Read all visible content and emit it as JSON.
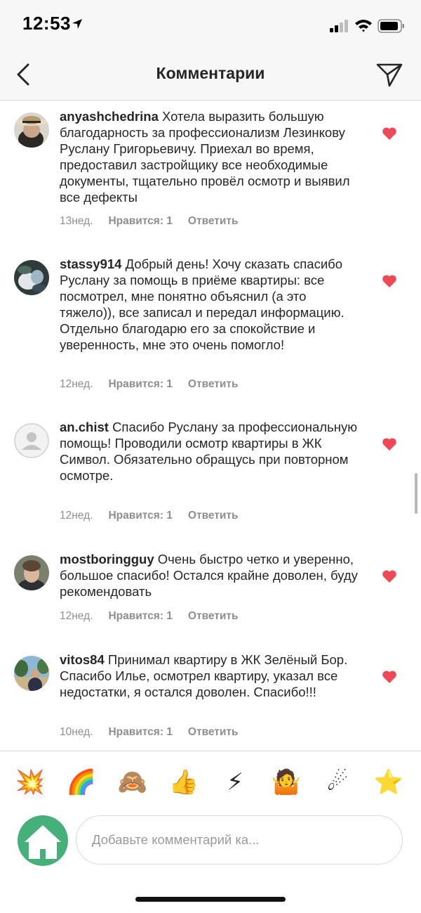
{
  "status": {
    "time": "12:53"
  },
  "header": {
    "title": "Комментарии"
  },
  "comments": [
    {
      "username": "anyashchedrina",
      "text": "Хотела выразить большую благодарность за профессионализм Лезинкову Руслану Григорьевичу. Приехал во время, предоставил застройщику все необходимые документы, тщательно провёл осмотр и выявил все дефекты",
      "age": "13нед.",
      "likes": "Нравится: 1",
      "reply": "Ответить"
    },
    {
      "username": "stassy914",
      "text": "Добрый день! Хочу сказать спасибо Руслану за помощь в приёме квартиры: все посмотрел, мне понятно объяснил (а это тяжело)), все записал и передал информацию. Отдельно благодарю его за спокойствие и уверенность, мне это очень помогло!",
      "age": "12нед.",
      "likes": "Нравится: 1",
      "reply": "Ответить"
    },
    {
      "username": "an.chist",
      "text": "Спасибо Руслану за профессиональную помощь! Проводили осмотр квартиры в ЖК Символ. Обязательно обращусь при повторном осмотре.",
      "age": "12нед.",
      "likes": "Нравится: 1",
      "reply": "Ответить"
    },
    {
      "username": "mostboringguy",
      "text": "Очень быстро четко и уверенно, большое спасибо! Остался крайне доволен, буду рекомендовать",
      "age": "12нед.",
      "likes": "Нравится: 1",
      "reply": "Ответить"
    },
    {
      "username": "vitos84",
      "text": "Принимал квартиру в ЖК Зелёный Бор. Спасибо Илье, осмотрел  квартиру, указал все недостатки, я остался доволен. Спасибо!!!",
      "age": "10нед.",
      "likes": "Нравится: 1",
      "reply": "Ответить"
    }
  ],
  "emojis": [
    "💥",
    "🌈",
    "🙈",
    "👍",
    "⚡",
    "🤷",
    "☄",
    "⭐"
  ],
  "composer": {
    "placeholder": "Добавьте комментарий ка..."
  },
  "colors": {
    "heart": "#ed4956",
    "meta": "#8e8e8e",
    "text": "#262626",
    "home_avatar": "#45b07a"
  }
}
